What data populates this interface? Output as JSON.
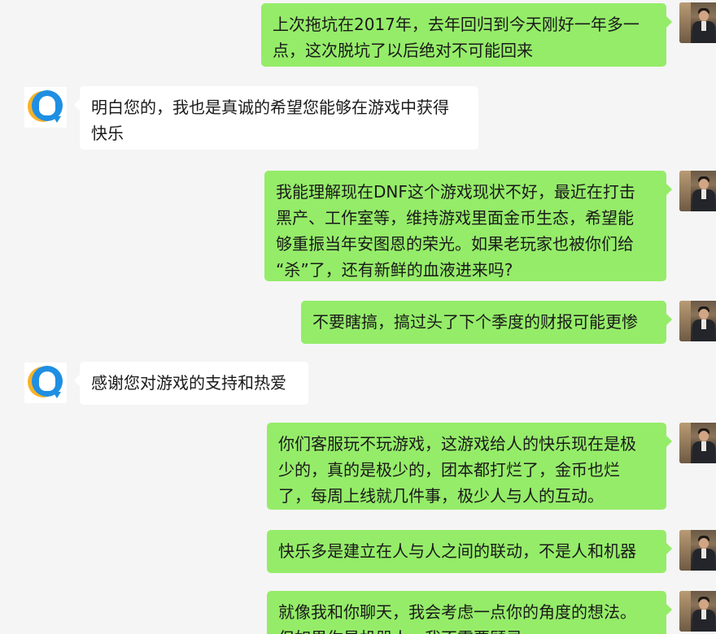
{
  "chat": {
    "messages": [
      {
        "sender": "self",
        "text": "上次拖坑在2017年，去年回归到今天刚好一年多一\n点，这次脱坑了以后绝对不可能回来"
      },
      {
        "sender": "bot",
        "text": "明白您的，我也是真诚的希望您能够在游戏中获得\n快乐"
      },
      {
        "sender": "self",
        "text": "我能理解现在DNF这个游戏现状不好，最近在打击\n黑产、工作室等，维持游戏里面金币生态，希望能\n够重振当年安图恩的荣光。如果老玩家也被你们给\n“杀”了，还有新鲜的血液进来吗?"
      },
      {
        "sender": "self",
        "text": "不要瞎搞，搞过头了下个季度的财报可能更惨"
      },
      {
        "sender": "bot",
        "text": "感谢您对游戏的支持和热爱"
      },
      {
        "sender": "self",
        "text": "你们客服玩不玩游戏，这游戏给人的快乐现在是极\n少的，真的是极少的，团本都打烂了，金币也烂\n了，每周上线就几件事，极少人与人的互动。"
      },
      {
        "sender": "self",
        "text": "快乐多是建立在人与人之间的联动，不是人和机器"
      },
      {
        "sender": "self",
        "text": "就像我和你聊天，我会考虑一点你的角度的想法。\n但如果你是机器人，我不需要顾忌"
      }
    ]
  },
  "colors": {
    "background": "#f5f5f5",
    "outgoing_bubble": "#95ec69",
    "incoming_bubble": "#ffffff"
  },
  "icons": {
    "self_avatar": "user-photo-avatar",
    "bot_avatar": "customer-service-penguin-avatar"
  }
}
